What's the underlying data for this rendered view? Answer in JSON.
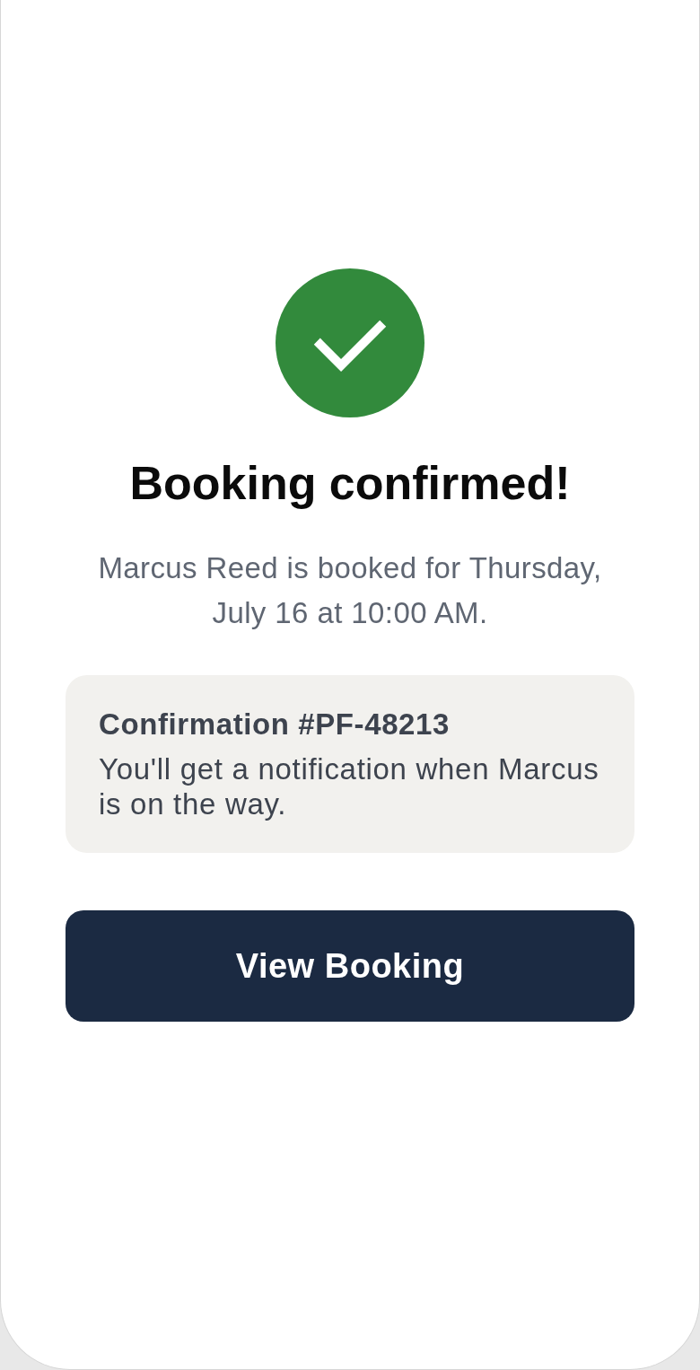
{
  "title": "Booking confirmed!",
  "message": "Marcus Reed is booked for Thursday, July 16 at 10:00 AM.",
  "confirmation_card": {
    "title": "Confirmation #PF-48213",
    "body": "You'll get a notification when Marcus is on the way."
  },
  "primary_button": {
    "label": "View Booking"
  }
}
